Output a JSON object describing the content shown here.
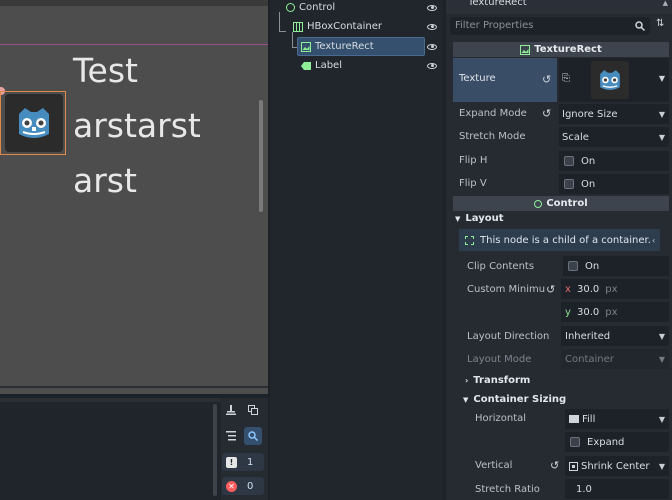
{
  "viewport": {
    "text_lines": [
      "Test",
      "arstarst",
      "arst"
    ]
  },
  "bottom_panel": {
    "badges": [
      {
        "icon": "warning-icon",
        "count": "1"
      },
      {
        "icon": "error-icon",
        "count": "0"
      }
    ]
  },
  "scene_tree": {
    "nodes": [
      {
        "label": "Control",
        "icon": "control-node-icon"
      },
      {
        "label": "HBoxContainer",
        "icon": "hbox-container-icon"
      },
      {
        "label": "TextureRect",
        "icon": "texture-rect-icon",
        "selected": true
      },
      {
        "label": "Label",
        "icon": "label-node-icon"
      }
    ]
  },
  "inspector": {
    "node_title": "TextureRect",
    "filter_placeholder": "Filter Properties",
    "texturerect_section": "TextureRect",
    "texture_label": "Texture",
    "expand_mode_label": "Expand Mode",
    "expand_mode_value": "Ignore Size",
    "stretch_mode_label": "Stretch Mode",
    "stretch_mode_value": "Scale",
    "flip_h_label": "Flip H",
    "flip_h_value": "On",
    "flip_v_label": "Flip V",
    "flip_v_value": "On",
    "control_section": "Control",
    "layout_header": "Layout",
    "info_text": "This node is a child of a container.",
    "clip_contents_label": "Clip Contents",
    "clip_contents_value": "On",
    "custom_min_label": "Custom Minimu",
    "custom_min_x_label": "x",
    "custom_min_x": "30.0",
    "custom_min_y_label": "y",
    "custom_min_y": "30.0",
    "unit": "px",
    "layout_direction_label": "Layout Direction",
    "layout_direction_value": "Inherited",
    "layout_mode_label": "Layout Mode",
    "layout_mode_value": "Container",
    "transform_header": "Transform",
    "container_sizing_header": "Container Sizing",
    "horizontal_label": "Horizontal",
    "horizontal_value": "Fill",
    "expand_label": "Expand",
    "vertical_label": "Vertical",
    "vertical_value": "Shrink Center",
    "stretch_ratio_label": "Stretch Ratio",
    "stretch_ratio_value": "1.0"
  },
  "colors": {
    "accent": "#35506e",
    "control_green": "#8eef97",
    "selection_orange": "#e08a4a"
  }
}
